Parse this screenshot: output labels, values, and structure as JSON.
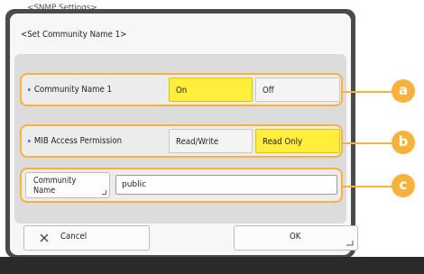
{
  "background_title": "<SNMP Settings>",
  "dialog": {
    "title": "<Set Community Name 1>"
  },
  "rows": {
    "community_name_1": {
      "label": "Community Name 1",
      "options": [
        {
          "label": "On",
          "selected": true
        },
        {
          "label": "Off",
          "selected": false
        }
      ]
    },
    "mib_access": {
      "label": "MIB Access Permission",
      "options": [
        {
          "label": "Read/Write",
          "selected": false
        },
        {
          "label": "Read Only",
          "selected": true
        }
      ]
    },
    "community_name": {
      "button_label": "Community\nName",
      "input_value": "public"
    }
  },
  "footer": {
    "cancel_label": "Cancel",
    "ok_label": "OK"
  },
  "callouts": [
    "a",
    "b",
    "c"
  ],
  "colors": {
    "callout": "#f6b23a",
    "selected": "#ffee3c",
    "bullet": "#2a6fc4"
  },
  "icons": [
    "close-icon",
    "enter-corner-icon"
  ]
}
